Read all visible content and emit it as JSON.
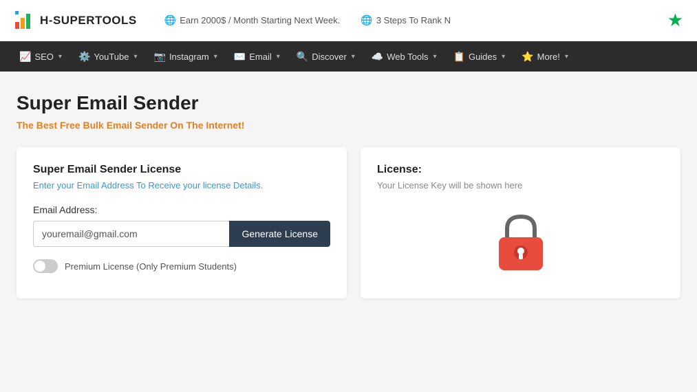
{
  "topbar": {
    "logo_text": "H-SUPERTOOLS",
    "promo1": "Earn 2000$ / Month Starting Next Week.",
    "promo2": "3 Steps To Rank N",
    "star_label": "★"
  },
  "navbar": {
    "items": [
      {
        "id": "seo",
        "icon": "📈",
        "label": "SEO"
      },
      {
        "id": "youtube",
        "icon": "⚙️",
        "label": "YouTube"
      },
      {
        "id": "instagram",
        "icon": "📷",
        "label": "Instagram"
      },
      {
        "id": "email",
        "icon": "✉️",
        "label": "Email"
      },
      {
        "id": "discover",
        "icon": "🔍",
        "label": "Discover"
      },
      {
        "id": "webtools",
        "icon": "☁️",
        "label": "Web Tools"
      },
      {
        "id": "guides",
        "icon": "📋",
        "label": "Guides"
      },
      {
        "id": "more",
        "icon": "⭐",
        "label": "More!"
      }
    ]
  },
  "main": {
    "page_title": "Super Email Sender",
    "page_subtitle": "The Best Free Bulk Email Sender On The Internet!",
    "left_card": {
      "title": "Super Email Sender License",
      "subtitle": "Enter your Email Address To Receive your license Details.",
      "field_label": "Email Address:",
      "input_placeholder": "youremail@gmail.com",
      "button_label": "Generate License",
      "toggle_label": "Premium License (Only Premium Students)"
    },
    "right_card": {
      "title": "License:",
      "placeholder_text": "Your License Key will be shown here"
    }
  }
}
